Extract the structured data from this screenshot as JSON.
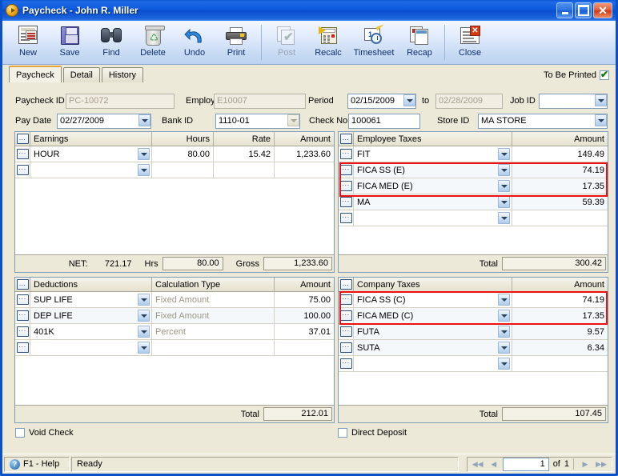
{
  "window": {
    "title": "Paycheck - John R. Miller",
    "title_icon": "play-circle-icon",
    "minimize_label": "_",
    "maximize_label": "□",
    "close_label": "✕"
  },
  "toolbar": {
    "buttons": [
      {
        "label": "New",
        "icon": "new-document-icon",
        "disabled": false
      },
      {
        "label": "Save",
        "icon": "floppy-disk-icon",
        "disabled": false
      },
      {
        "label": "Find",
        "icon": "binoculars-icon",
        "disabled": false
      },
      {
        "label": "Delete",
        "icon": "recycle-bin-icon",
        "disabled": false
      },
      {
        "label": "Undo",
        "icon": "undo-arrow-icon",
        "disabled": false
      },
      {
        "label": "Print",
        "icon": "printer-icon",
        "disabled": false
      },
      {
        "label": "Post",
        "icon": "post-check-icon",
        "disabled": true
      },
      {
        "label": "Recalc",
        "icon": "calculator-icon",
        "disabled": false
      },
      {
        "label": "Timesheet",
        "icon": "timesheet-clock-icon",
        "disabled": false
      },
      {
        "label": "Recap",
        "icon": "recap-pages-icon",
        "disabled": false
      },
      {
        "label": "Close",
        "icon": "close-document-icon",
        "disabled": false
      }
    ]
  },
  "tabs": {
    "items": [
      {
        "label": "Paycheck",
        "active": true
      },
      {
        "label": "Detail",
        "active": false
      },
      {
        "label": "History",
        "active": false
      }
    ],
    "to_be_printed_label": "To Be Printed",
    "to_be_printed_checked": true
  },
  "form": {
    "paycheck_id_label": "Paycheck ID",
    "paycheck_id_value": "PC-10072",
    "employee_id_label": "Employee ID",
    "employee_id_value": "E10007",
    "period_label": "Period",
    "period_from_value": "02/15/2009",
    "period_to_label": "to",
    "period_to_value": "02/28/2009",
    "job_id_label": "Job ID",
    "job_id_value": "",
    "pay_date_label": "Pay Date",
    "pay_date_value": "02/27/2009",
    "bank_id_label": "Bank ID",
    "bank_id_value": "1110-01",
    "check_no_label": "Check No",
    "check_no_value": "100061",
    "store_id_label": "Store ID",
    "store_id_value": "MA STORE"
  },
  "earnings": {
    "columns": [
      "Earnings",
      "Hours",
      "Rate",
      "Amount"
    ],
    "rows": [
      {
        "name": "HOUR",
        "hours": "80.00",
        "rate": "15.42",
        "amount": "1,233.60"
      },
      {
        "name": "",
        "hours": "",
        "rate": "",
        "amount": ""
      }
    ],
    "net_label": "NET:",
    "net_value": "721.17",
    "hrs_label": "Hrs",
    "hrs_value": "80.00",
    "gross_label": "Gross",
    "gross_value": "1,233.60"
  },
  "employee_taxes": {
    "columns": [
      "Employee Taxes",
      "Amount"
    ],
    "rows": [
      {
        "name": "FIT",
        "amount": "149.49",
        "highlight": false
      },
      {
        "name": "FICA SS (E)",
        "amount": "74.19",
        "highlight": true
      },
      {
        "name": "FICA MED (E)",
        "amount": "17.35",
        "highlight": true
      },
      {
        "name": "MA",
        "amount": "59.39",
        "highlight": false
      },
      {
        "name": "",
        "amount": "",
        "highlight": false
      }
    ],
    "total_label": "Total",
    "total_value": "300.42"
  },
  "deductions": {
    "columns": [
      "Deductions",
      "Calculation Type",
      "Amount"
    ],
    "rows": [
      {
        "name": "SUP LIFE",
        "calc": "Fixed Amount",
        "amount": "75.00"
      },
      {
        "name": "DEP LIFE",
        "calc": "Fixed Amount",
        "amount": "100.00"
      },
      {
        "name": "401K",
        "calc": "Percent",
        "amount": "37.01"
      },
      {
        "name": "",
        "calc": "",
        "amount": ""
      }
    ],
    "total_label": "Total",
    "total_value": "212.01"
  },
  "company_taxes": {
    "columns": [
      "Company Taxes",
      "Amount"
    ],
    "rows": [
      {
        "name": "FICA SS (C)",
        "amount": "74.19",
        "highlight": true
      },
      {
        "name": "FICA MED (C)",
        "amount": "17.35",
        "highlight": true
      },
      {
        "name": "FUTA",
        "amount": "9.57",
        "highlight": false
      },
      {
        "name": "SUTA",
        "amount": "6.34",
        "highlight": false
      },
      {
        "name": "",
        "amount": "",
        "highlight": false
      }
    ],
    "total_label": "Total",
    "total_value": "107.45"
  },
  "footer": {
    "void_check_label": "Void Check",
    "void_check_checked": false,
    "direct_deposit_label": "Direct Deposit",
    "direct_deposit_checked": false
  },
  "statusbar": {
    "help_label": "F1 - Help",
    "help_icon": "question-circle-icon",
    "status_text": "Ready",
    "first_icon": "nav-first-icon",
    "prev_icon": "nav-prev-icon",
    "next_icon": "nav-next-icon",
    "last_icon": "nav-last-icon",
    "page_value": "1",
    "of_label": "of",
    "page_total": "1"
  },
  "colors": {
    "title_blue": "#0a50c8",
    "highlight_red": "#ee1111",
    "face": "#ece9d8",
    "field_border": "#7f9db9"
  }
}
